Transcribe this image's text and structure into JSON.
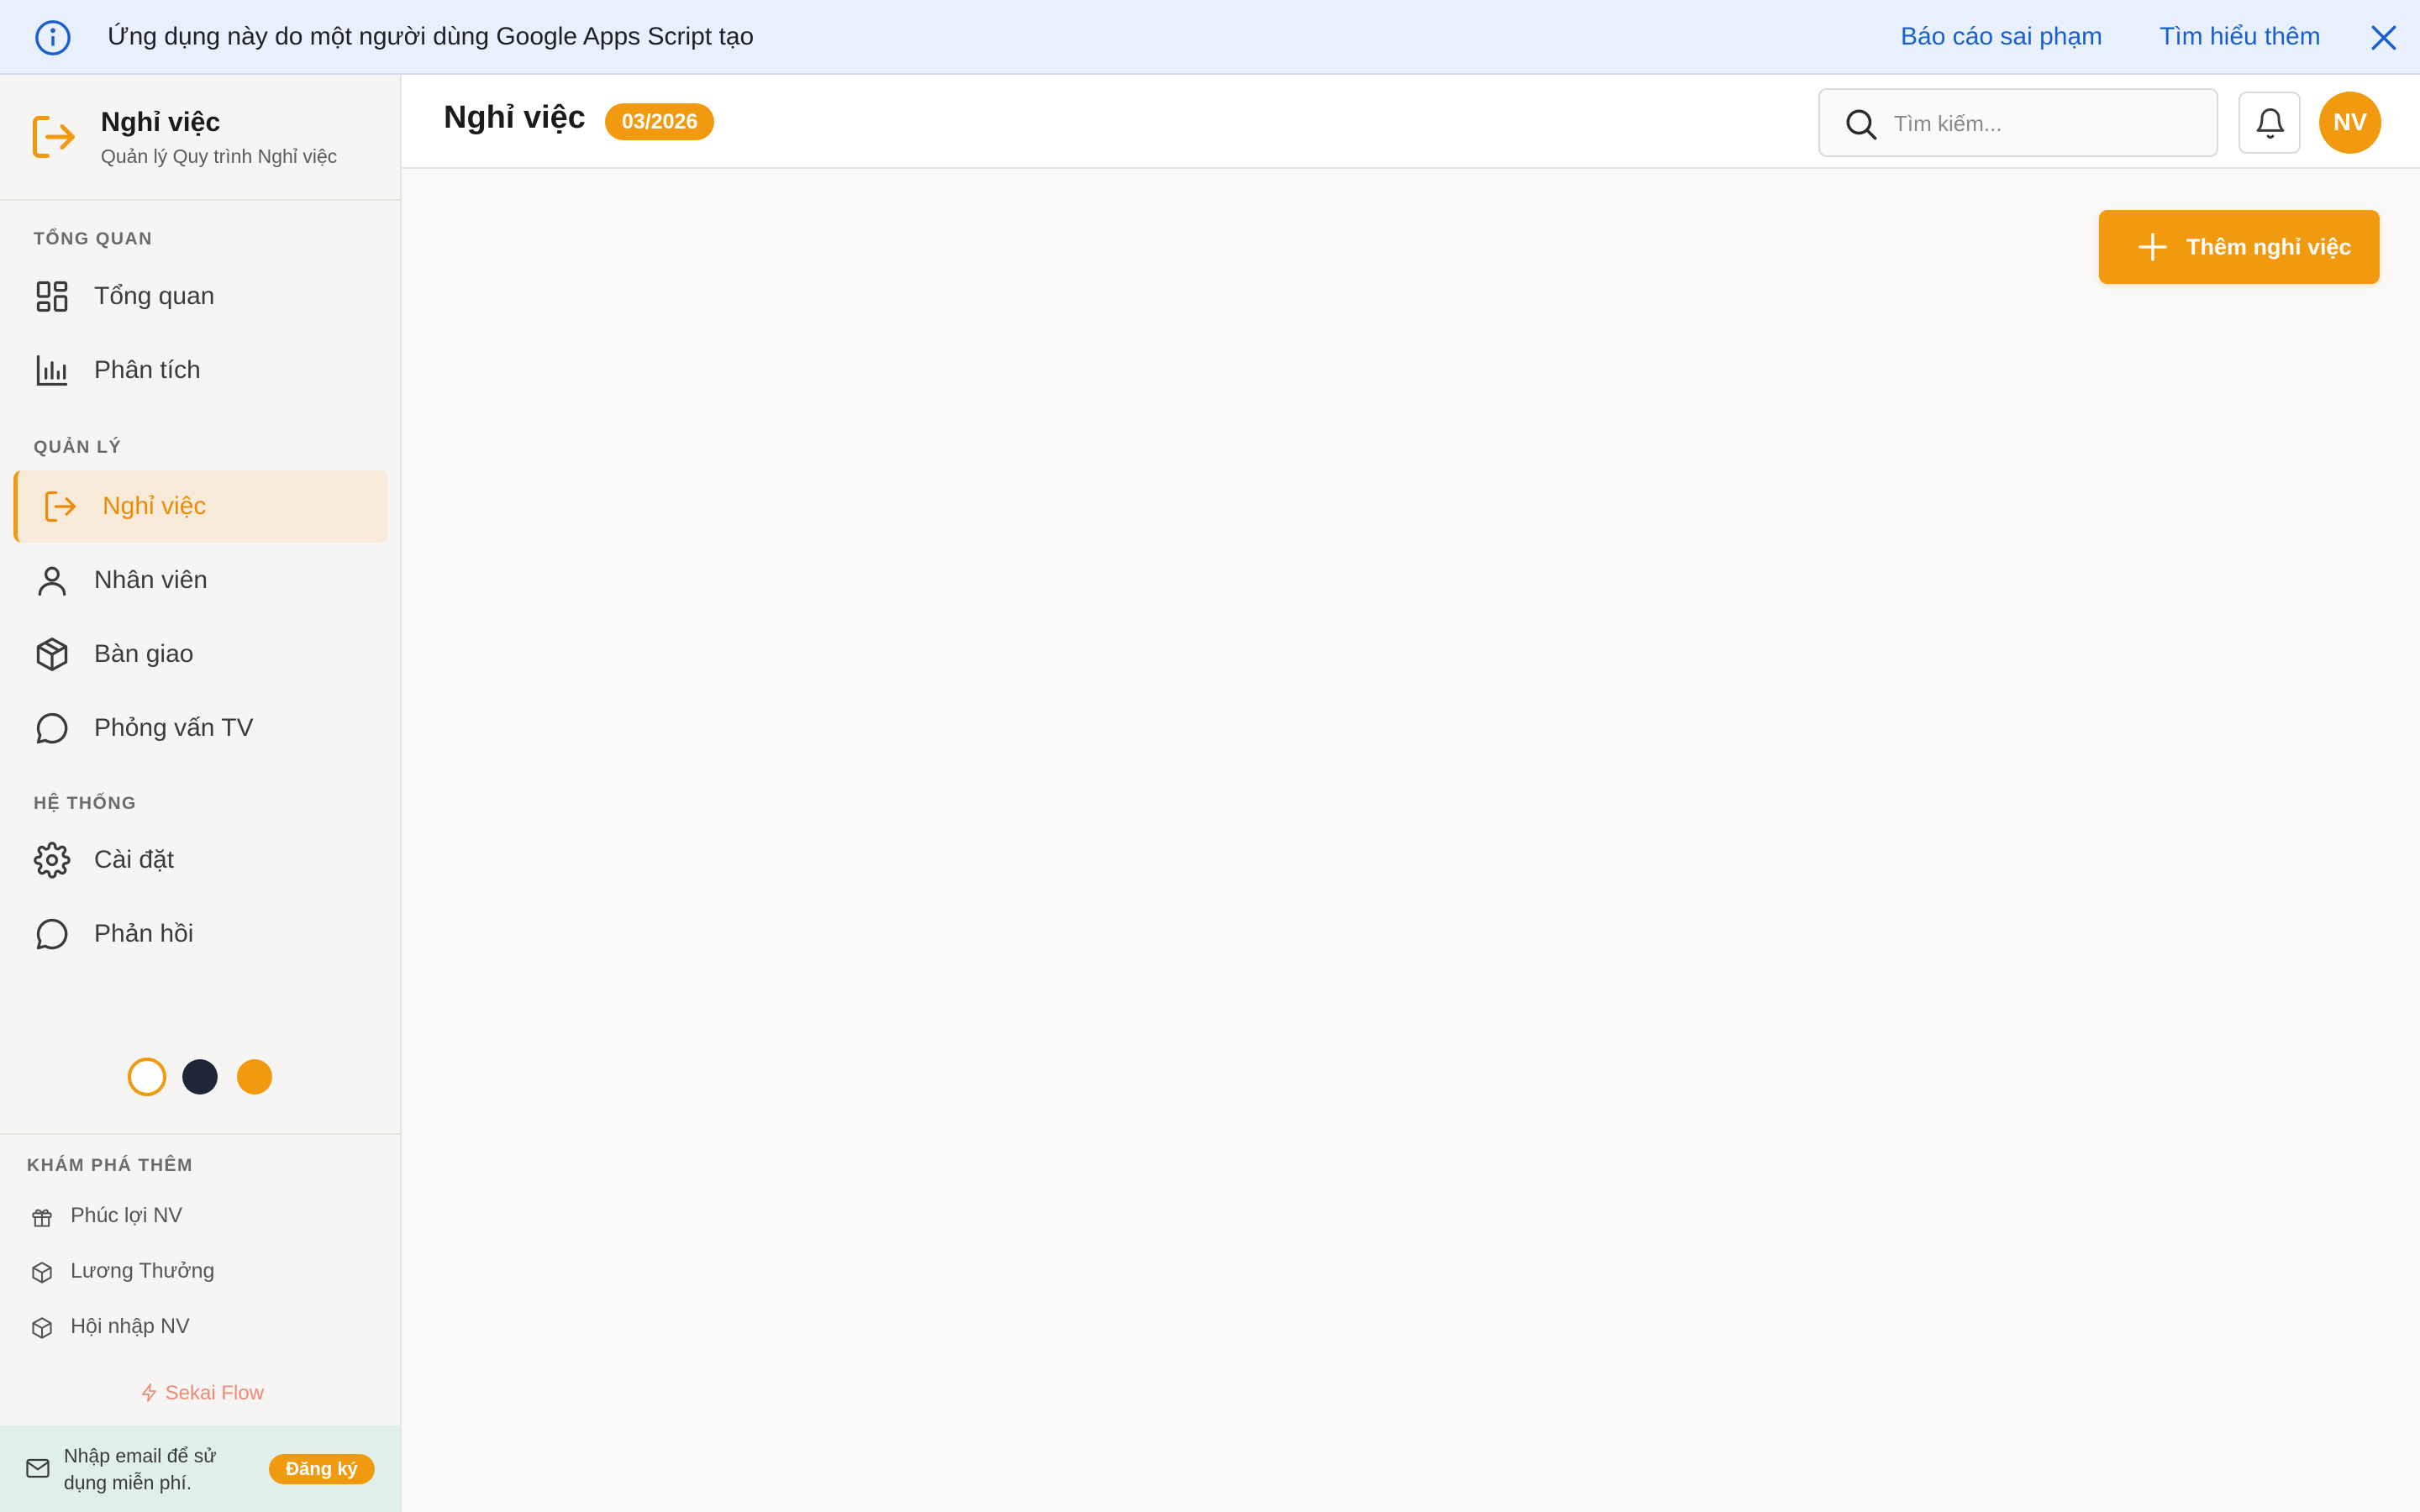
{
  "banner": {
    "text": "Ứng dụng này do một người dùng Google Apps Script tạo",
    "report_link": "Báo cáo sai phạm",
    "learn_link": "Tìm hiểu thêm"
  },
  "brand": {
    "title": "Nghỉ việc",
    "subtitle": "Quản lý Quy trình Nghỉ việc"
  },
  "sidebar": {
    "sections": [
      {
        "label": "TỔNG QUAN",
        "items": [
          {
            "label": "Tổng quan",
            "icon": "dashboard-icon"
          },
          {
            "label": "Phân tích",
            "icon": "bar-chart-icon"
          }
        ]
      },
      {
        "label": "QUẢN LÝ",
        "items": [
          {
            "label": "Nghỉ việc",
            "icon": "logout-icon",
            "active": true
          },
          {
            "label": "Nhân viên",
            "icon": "user-icon"
          },
          {
            "label": "Bàn giao",
            "icon": "package-icon"
          },
          {
            "label": "Phỏng vấn TV",
            "icon": "chat-bubble-icon"
          }
        ]
      },
      {
        "label": "HỆ THỐNG",
        "items": [
          {
            "label": "Cài đặt",
            "icon": "gear-icon"
          },
          {
            "label": "Phản hồi",
            "icon": "chat-bubble-icon"
          }
        ]
      }
    ],
    "themes": [
      {
        "name": "light",
        "color": "#ffffff",
        "border": "#f29a0f",
        "selected": true
      },
      {
        "name": "dark",
        "color": "#1e2637"
      },
      {
        "name": "orange",
        "color": "#f29a0f"
      }
    ],
    "explore": {
      "label": "KHÁM PHÁ THÊM",
      "items": [
        {
          "label": "Phúc lợi NV",
          "icon": "gift-icon"
        },
        {
          "label": "Lương Thưởng",
          "icon": "cube-icon"
        },
        {
          "label": "Hội nhập NV",
          "icon": "cube-icon"
        }
      ]
    },
    "powered_by": "Sekai Flow",
    "signup": {
      "text": "Nhập email để sử dụng miễn phí.",
      "button": "Đăng ký"
    }
  },
  "header": {
    "title": "Nghỉ việc",
    "period": "03/2026",
    "search_placeholder": "Tìm kiếm...",
    "avatar_initials": "NV"
  },
  "main": {
    "add_button": "Thêm nghỉ việc"
  },
  "colors": {
    "accent": "#f29a0f",
    "link": "#1a5fd0",
    "banner_bg": "#e8f0fe",
    "active_bg": "#f8ead8"
  }
}
